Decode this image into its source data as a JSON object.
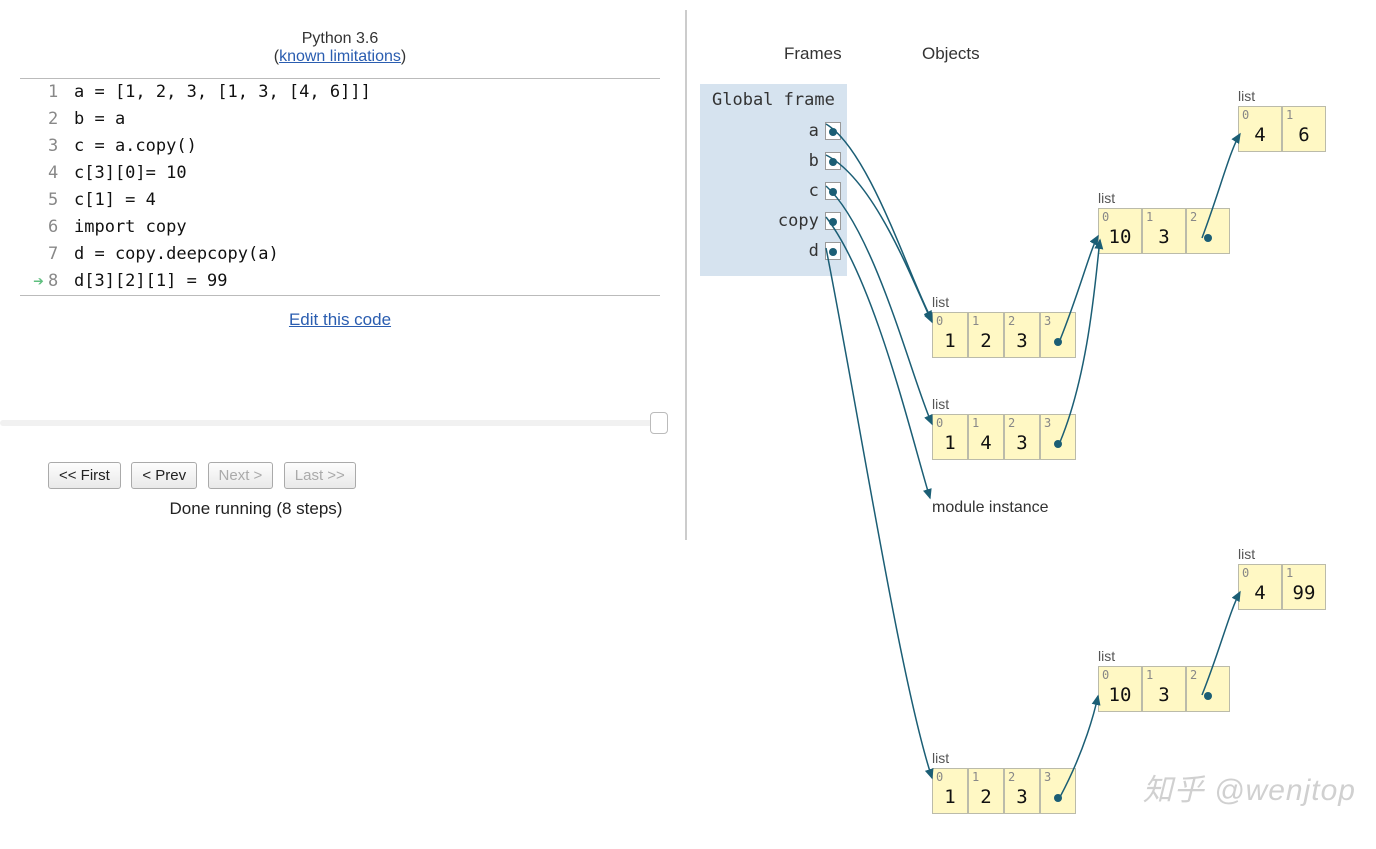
{
  "header": {
    "title": "Python 3.6",
    "limitations_prefix": "(",
    "limitations_link": "known limitations",
    "limitations_suffix": ")"
  },
  "code": {
    "lines": [
      "a = [1, 2, 3, [1, 3, [4, 6]]]",
      "b = a",
      "c = a.copy()",
      "c[3][0]= 10",
      "c[1] = 4",
      "import copy",
      "d = copy.deepcopy(a)",
      "d[3][2][1] = 99"
    ],
    "current_line": 8,
    "edit_label": "Edit this code"
  },
  "controls": {
    "first": "<< First",
    "prev": "< Prev",
    "next": "Next >",
    "last": "Last >>",
    "status": "Done running (8 steps)"
  },
  "columns": {
    "frames": "Frames",
    "objects": "Objects"
  },
  "frame": {
    "title": "Global frame",
    "vars": [
      "a",
      "b",
      "c",
      "copy",
      "d"
    ]
  },
  "objects": {
    "list_label": "list",
    "module_label": "module instance",
    "lists": {
      "a": {
        "cells": [
          {
            "idx": "0",
            "val": "1"
          },
          {
            "idx": "1",
            "val": "2"
          },
          {
            "idx": "2",
            "val": "3"
          },
          {
            "idx": "3",
            "ref": true
          }
        ]
      },
      "c": {
        "cells": [
          {
            "idx": "0",
            "val": "1"
          },
          {
            "idx": "1",
            "val": "4"
          },
          {
            "idx": "2",
            "val": "3"
          },
          {
            "idx": "3",
            "ref": true
          }
        ]
      },
      "inner_ac": {
        "cells": [
          {
            "idx": "0",
            "val": "10"
          },
          {
            "idx": "1",
            "val": "3"
          },
          {
            "idx": "2",
            "ref": true
          }
        ]
      },
      "leaf_ac": {
        "cells": [
          {
            "idx": "0",
            "val": "4"
          },
          {
            "idx": "1",
            "val": "6"
          }
        ]
      },
      "d": {
        "cells": [
          {
            "idx": "0",
            "val": "1"
          },
          {
            "idx": "1",
            "val": "2"
          },
          {
            "idx": "2",
            "val": "3"
          },
          {
            "idx": "3",
            "ref": true
          }
        ]
      },
      "inner_d": {
        "cells": [
          {
            "idx": "0",
            "val": "10"
          },
          {
            "idx": "1",
            "val": "3"
          },
          {
            "idx": "2",
            "ref": true
          }
        ]
      },
      "leaf_d": {
        "cells": [
          {
            "idx": "0",
            "val": "4"
          },
          {
            "idx": "1",
            "val": "99"
          }
        ]
      }
    }
  },
  "watermark": "知乎 @wenjtop"
}
